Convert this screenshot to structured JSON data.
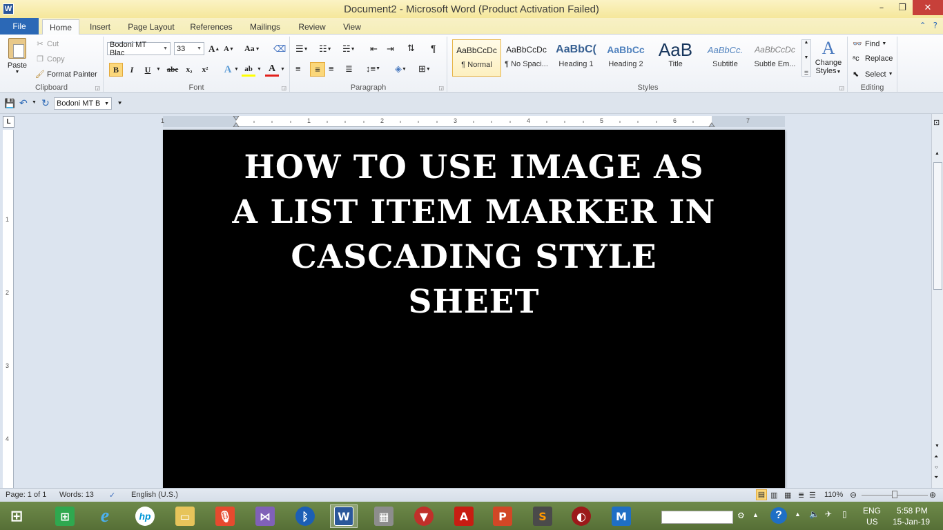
{
  "window": {
    "title": "Document2 - Microsoft Word (Product Activation Failed)",
    "app_letter": "W",
    "minimize": "–",
    "restore": "❐",
    "close": "✕"
  },
  "tabs": [
    "File",
    "Home",
    "Insert",
    "Page Layout",
    "References",
    "Mailings",
    "Review",
    "View"
  ],
  "ribbon": {
    "clipboard": {
      "label": "Clipboard",
      "paste": "Paste",
      "cut": "Cut",
      "copy": "Copy",
      "format_painter": "Format Painter"
    },
    "font": {
      "label": "Font",
      "name": "Bodoni MT Blac",
      "size": "33",
      "grow": "A",
      "shrink": "A",
      "change_case": "Aa",
      "bold": "B",
      "italic": "I",
      "underline": "U",
      "strike": "abc",
      "subscript": "x₂",
      "superscript": "x²",
      "text_effects": "A",
      "highlight": "ab",
      "font_color": "A"
    },
    "paragraph": {
      "label": "Paragraph",
      "pilcrow": "¶"
    },
    "styles": {
      "label": "Styles",
      "items": [
        {
          "sample": "AaBbCcDc",
          "name": "¶ Normal"
        },
        {
          "sample": "AaBbCcDc",
          "name": "¶ No Spaci..."
        },
        {
          "sample": "AaBbC(",
          "name": "Heading 1"
        },
        {
          "sample": "AaBbCc",
          "name": "Heading 2"
        },
        {
          "sample": "AaB",
          "name": "Title"
        },
        {
          "sample": "AaBbCc.",
          "name": "Subtitle"
        },
        {
          "sample": "AaBbCcDc",
          "name": "Subtle Em..."
        }
      ],
      "change_styles_line1": "Change",
      "change_styles_line2": "Styles"
    },
    "editing": {
      "label": "Editing",
      "find": "Find",
      "replace": "Replace",
      "select": "Select"
    }
  },
  "qat": {
    "font": "Bodoni MT B"
  },
  "ruler": {
    "numbers": [
      "1",
      "1",
      "2",
      "3",
      "4",
      "5",
      "6",
      "7"
    ],
    "vnumbers": [
      "1",
      "2",
      "3",
      "4"
    ]
  },
  "document": {
    "heading": "HOW TO USE IMAGE AS A LIST ITEM MARKER IN CASCADING STYLE SHEET",
    "background": "#000000",
    "text_color": "#ffffff"
  },
  "status": {
    "page": "Page: 1 of 1",
    "words": "Words: 13",
    "language": "English (U.S.)",
    "zoom": "110%"
  },
  "taskbar": {
    "lang_top": "ENG",
    "lang_bottom": "US",
    "time": "5:58 PM",
    "date": "15-Jan-19",
    "help": "?"
  },
  "colors": {
    "file_tab": "#2b68b6",
    "titlebar": "#f5e79b",
    "taskbar": "#5f7a3e",
    "close": "#c7403a"
  }
}
